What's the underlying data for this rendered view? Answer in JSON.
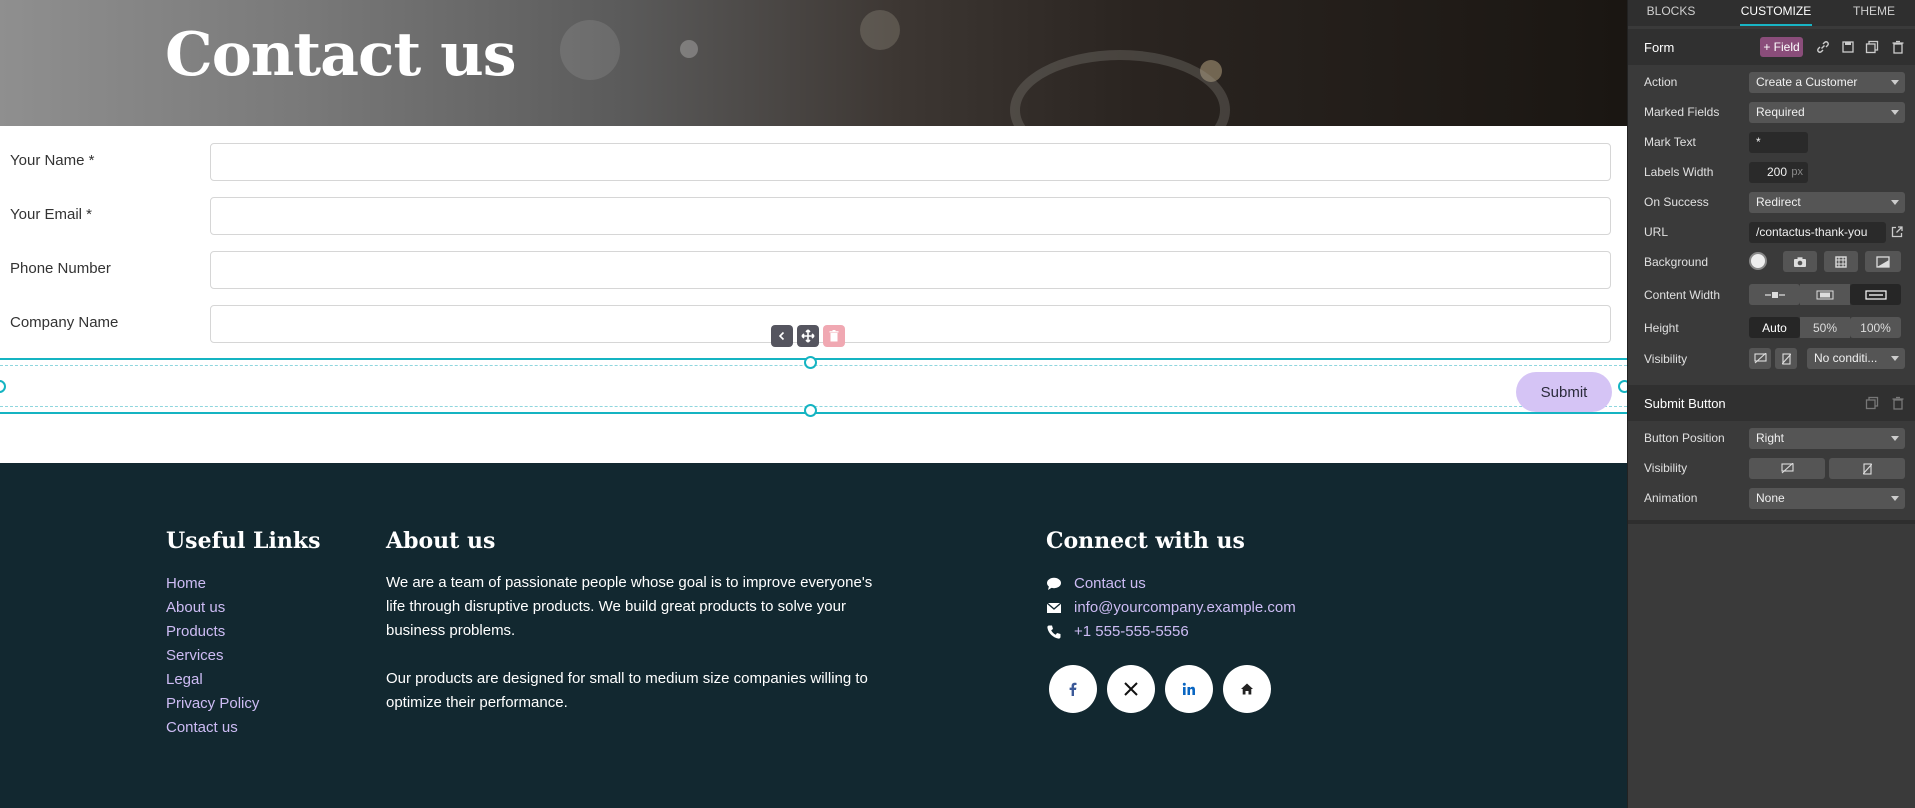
{
  "hero": {
    "title": "Contact us"
  },
  "form": {
    "fields": [
      {
        "label": "Your Name *"
      },
      {
        "label": "Your Email *"
      },
      {
        "label": "Phone Number"
      },
      {
        "label": "Company Name"
      }
    ],
    "submit_label": "Submit"
  },
  "footer": {
    "useful_links": {
      "title": "Useful Links",
      "items": [
        "Home",
        "About us",
        "Products",
        "Services",
        "Legal",
        "Privacy Policy",
        "Contact us"
      ]
    },
    "about": {
      "title": "About us",
      "lines1": [
        "We are a team of passionate people whose goal is to improve everyone's",
        "life through disruptive products. We build great products to solve your",
        "business problems."
      ],
      "lines2": [
        "Our products are designed for small to medium size companies willing to",
        "optimize their performance."
      ]
    },
    "connect": {
      "title": "Connect with us",
      "contact_link": "Contact us",
      "email": "info@yourcompany.example.com",
      "phone": "+1 555-555-5556"
    }
  },
  "panel": {
    "tabs": [
      "BLOCKS",
      "CUSTOMIZE",
      "THEME"
    ],
    "active_tab": "CUSTOMIZE",
    "form_section": {
      "title": "Form",
      "add_field_label": "+ Field",
      "rows": {
        "action": {
          "label": "Action",
          "value": "Create a Customer"
        },
        "marked_fields": {
          "label": "Marked Fields",
          "value": "Required"
        },
        "mark_text": {
          "label": "Mark Text",
          "value": "*"
        },
        "labels_width": {
          "label": "Labels Width",
          "value": "200",
          "unit": "px"
        },
        "on_success": {
          "label": "On Success",
          "value": "Redirect"
        },
        "url": {
          "label": "URL",
          "value": "/contactus-thank-you"
        },
        "background": {
          "label": "Background"
        },
        "content_width": {
          "label": "Content Width"
        },
        "height": {
          "label": "Height",
          "options": [
            "Auto",
            "50%",
            "100%"
          ],
          "selected": "Auto"
        },
        "visibility": {
          "label": "Visibility",
          "value": "No conditi..."
        }
      }
    },
    "submit_section": {
      "title": "Submit Button",
      "rows": {
        "button_position": {
          "label": "Button Position",
          "value": "Right"
        },
        "visibility": {
          "label": "Visibility"
        },
        "animation": {
          "label": "Animation",
          "value": "None"
        }
      }
    },
    "accent_color": "#18b4c4"
  }
}
